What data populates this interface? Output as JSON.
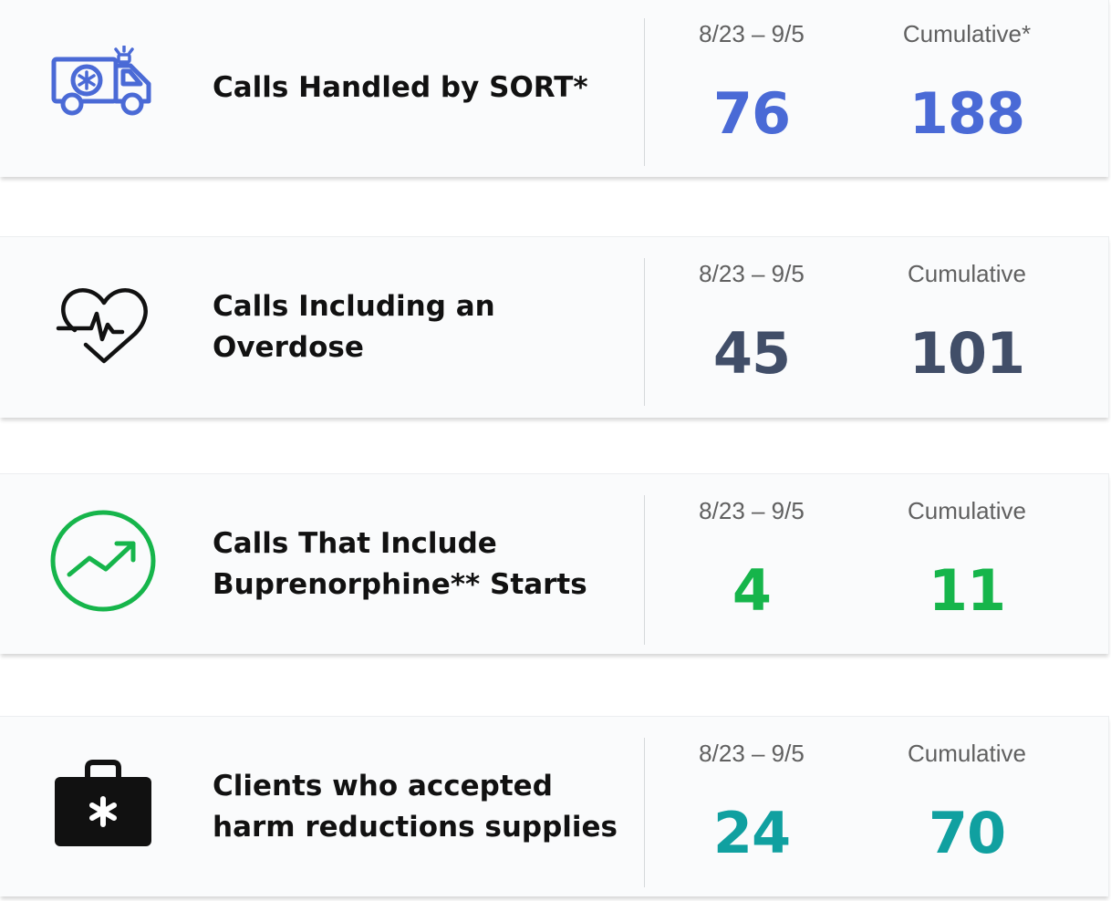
{
  "colors": {
    "blue": "#4a6ad6",
    "navy": "#414e68",
    "green": "#16b54b",
    "teal": "#10a0a0"
  },
  "cards": [
    {
      "icon": "ambulance-icon",
      "label_lines": [
        "Calls Handled by SORT*"
      ],
      "period_label": "8/23 – 9/5",
      "cumulative_label": "Cumulative*",
      "period_value": "76",
      "cumulative_value": "188",
      "color": "#4a6ad6"
    },
    {
      "icon": "heartbeat-icon",
      "label_lines": [
        "Calls Including an",
        "Overdose"
      ],
      "period_label": "8/23 – 9/5",
      "cumulative_label": "Cumulative",
      "period_value": "45",
      "cumulative_value": "101",
      "color": "#414e68"
    },
    {
      "icon": "trend-up-icon",
      "label_lines": [
        "Calls That Include",
        "Buprenorphine** Starts"
      ],
      "period_label": "8/23 – 9/5",
      "cumulative_label": "Cumulative",
      "period_value": "4",
      "cumulative_value": "11",
      "color": "#16b54b"
    },
    {
      "icon": "medical-kit-icon",
      "label_lines": [
        "Clients who accepted",
        "harm reductions supplies"
      ],
      "period_label": "8/23 – 9/5",
      "cumulative_label": "Cumulative",
      "period_value": "24",
      "cumulative_value": "70",
      "color": "#10a0a0"
    }
  ]
}
